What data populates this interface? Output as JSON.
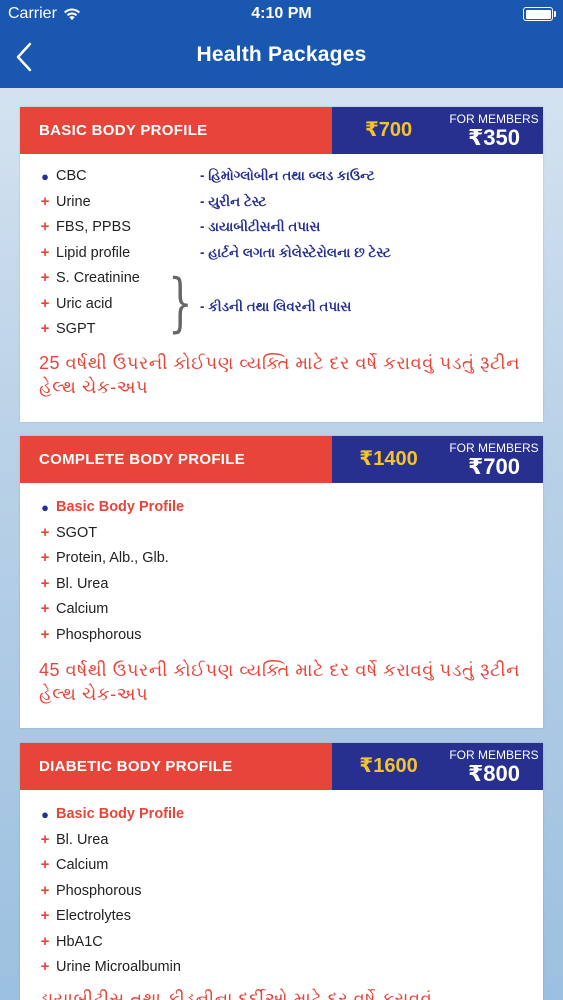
{
  "status_bar": {
    "carrier": "Carrier",
    "time": "4:10 PM"
  },
  "nav": {
    "title": "Health Packages",
    "back_icon": "chevron-left-icon"
  },
  "colors": {
    "nav_blue": "#1a57b0",
    "header_red": "#e8453a",
    "price_navy": "#27308f",
    "price_gold": "#f4c32a"
  },
  "packages": [
    {
      "name": "BASIC BODY PROFILE",
      "price": "₹700",
      "members_label": "FOR MEMBERS",
      "members_price": "₹350",
      "items": [
        {
          "bullet": "●",
          "label": "CBC",
          "note": "- હિમોગ્લોબીન તથા બ્લડ કાઉન્ટ"
        },
        {
          "bullet": "+",
          "label": "Urine",
          "note": "- યુરીન ટેસ્ટ"
        },
        {
          "bullet": "+",
          "label": "FBS, PPBS",
          "note": "- ડાયાબીટીસની તપાસ"
        },
        {
          "bullet": "+",
          "label": "Lipid profile",
          "note": "- હાર્ટને લગતા કોલેસ્ટેરોલના છ ટેસ્ટ"
        },
        {
          "bullet": "+",
          "label": "S. Creatinine"
        },
        {
          "bullet": "+",
          "label": "Uric acid"
        },
        {
          "bullet": "+",
          "label": "SGPT"
        }
      ],
      "group_note": "- કીડની તથા લિવરની તપાસ",
      "remark": "25 વર્ષથી ઉપરની કોઈપણ વ્યક્તિ માટે દર વર્ષે કરાવવું પડતું રૂટીન હેલ્થ ચેક-અપ"
    },
    {
      "name": "COMPLETE BODY PROFILE",
      "price": "₹1400",
      "members_label": "FOR MEMBERS",
      "members_price": "₹700",
      "items": [
        {
          "bullet": "●",
          "label": "Basic Body Profile"
        },
        {
          "bullet": "+",
          "label": "SGOT"
        },
        {
          "bullet": "+",
          "label": "Protein, Alb., Glb."
        },
        {
          "bullet": "+",
          "label": "Bl. Urea"
        },
        {
          "bullet": "+",
          "label": "Calcium"
        },
        {
          "bullet": "+",
          "label": "Phosphorous"
        }
      ],
      "remark": "45 વર્ષથી ઉપરની કોઈપણ વ્યક્તિ માટે દર વર્ષે કરાવવું પડતું રૂટીન હેલ્થ ચેક-અપ"
    },
    {
      "name": "DIABETIC BODY PROFILE",
      "price": "₹1600",
      "members_label": "FOR MEMBERS",
      "members_price": "₹800",
      "items": [
        {
          "bullet": "●",
          "label": "Basic Body Profile"
        },
        {
          "bullet": "+",
          "label": "Bl. Urea"
        },
        {
          "bullet": "+",
          "label": "Calcium"
        },
        {
          "bullet": "+",
          "label": "Phosphorous"
        },
        {
          "bullet": "+",
          "label": "Electrolytes"
        },
        {
          "bullet": "+",
          "label": "HbA1C"
        },
        {
          "bullet": "+",
          "label": "Urine Microalbumin"
        }
      ],
      "remark": "ડાયાબીટીસ તથા કીડનીના દર્દીઓ માટે દર વર્ષે કરાવવું"
    }
  ]
}
